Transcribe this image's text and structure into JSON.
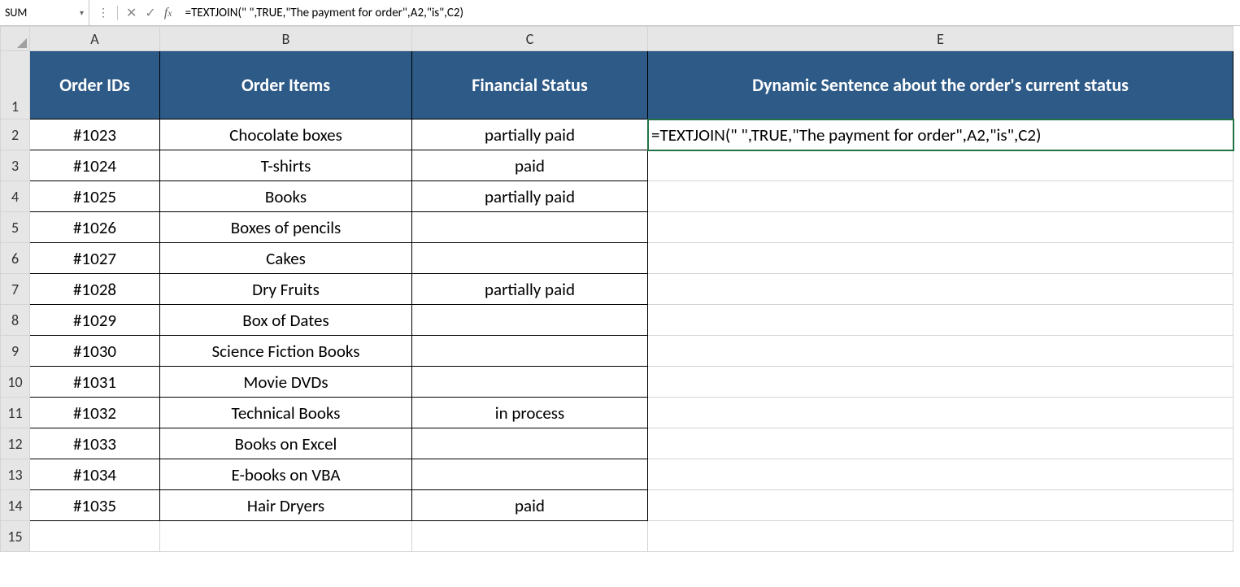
{
  "formula_bar": {
    "name_box": "SUM",
    "formula": "=TEXTJOIN(\" \",TRUE,\"The payment for order\",A2,\"is\",C2)"
  },
  "columns": {
    "A": "A",
    "B": "B",
    "C": "C",
    "E": "E"
  },
  "headers": {
    "A": "Order IDs",
    "B": "Order Items",
    "C": "Financial Status",
    "E": "Dynamic Sentence about the order's current status"
  },
  "rows": [
    {
      "n": "2",
      "a": "#1023",
      "b": "Chocolate boxes",
      "c": "partially paid",
      "e": "=TEXTJOIN(\" \",TRUE,\"The payment for order\",A2,\"is\",C2)"
    },
    {
      "n": "3",
      "a": "#1024",
      "b": "T-shirts",
      "c": "paid",
      "e": ""
    },
    {
      "n": "4",
      "a": "#1025",
      "b": "Books",
      "c": "partially paid",
      "e": ""
    },
    {
      "n": "5",
      "a": "#1026",
      "b": "Boxes of pencils",
      "c": "",
      "e": ""
    },
    {
      "n": "6",
      "a": "#1027",
      "b": "Cakes",
      "c": "",
      "e": ""
    },
    {
      "n": "7",
      "a": "#1028",
      "b": "Dry Fruits",
      "c": "partially paid",
      "e": ""
    },
    {
      "n": "8",
      "a": "#1029",
      "b": "Box of Dates",
      "c": "",
      "e": ""
    },
    {
      "n": "9",
      "a": "#1030",
      "b": "Science Fiction Books",
      "c": "",
      "e": ""
    },
    {
      "n": "10",
      "a": "#1031",
      "b": "Movie DVDs",
      "c": "",
      "e": ""
    },
    {
      "n": "11",
      "a": "#1032",
      "b": "Technical Books",
      "c": "in process",
      "e": ""
    },
    {
      "n": "12",
      "a": "#1033",
      "b": "Books on Excel",
      "c": "",
      "e": ""
    },
    {
      "n": "13",
      "a": "#1034",
      "b": "E-books on VBA",
      "c": "",
      "e": ""
    },
    {
      "n": "14",
      "a": "#1035",
      "b": "Hair Dryers",
      "c": "paid",
      "e": ""
    }
  ],
  "blank_row": "15",
  "header_row_num": "1"
}
